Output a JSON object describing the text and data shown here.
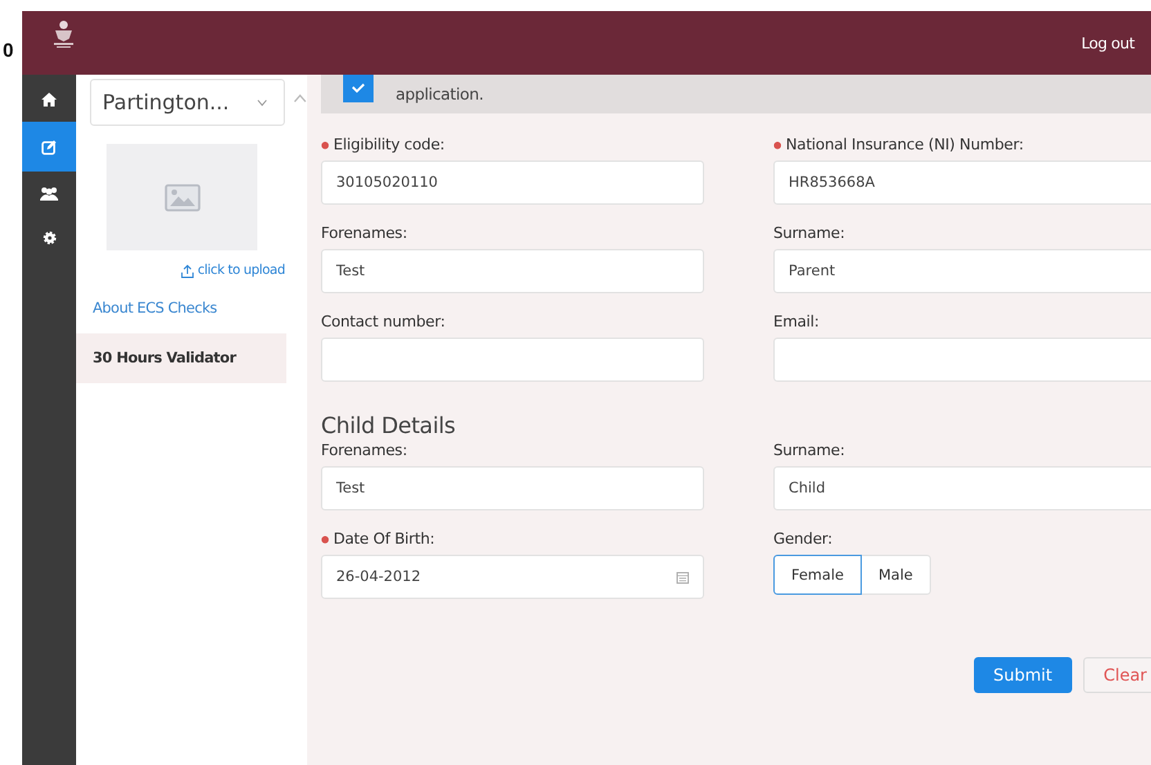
{
  "edge_text": "0",
  "header": {
    "logout": "Log out"
  },
  "rail": [
    {
      "selected": false
    },
    {
      "selected": true
    },
    {
      "selected": false
    },
    {
      "selected": false
    }
  ],
  "sidebar": {
    "select": "Partington...",
    "upload": "click to upload",
    "items": [
      {
        "label": "About ECS Checks",
        "selected": false
      },
      {
        "label": "30 Hours Validator",
        "selected": true
      }
    ]
  },
  "consent": {
    "checked": true,
    "text": "application."
  },
  "fields": [
    {
      "label": "Eligibility code:",
      "required": true,
      "value": "30105020110"
    },
    {
      "label": "National Insurance (NI) Number:",
      "required": true,
      "value": "HR853668A"
    },
    {
      "label": "Forenames:",
      "required": false,
      "value": "Test"
    },
    {
      "label": "Surname:",
      "required": false,
      "value": "Parent"
    },
    {
      "label": "Contact number:",
      "required": false
    },
    {
      "label": "Email:",
      "required": false
    }
  ],
  "child": {
    "heading": "Child Details",
    "fields": [
      {
        "label": "Forenames:",
        "required": false,
        "value": "Test"
      },
      {
        "label": "Surname:",
        "required": false,
        "value": "Child"
      }
    ],
    "dob": {
      "label": "Date Of Birth:",
      "required": true,
      "value": "26-04-2012"
    },
    "gender": {
      "label": "Gender:",
      "options": [
        {
          "label": "Female",
          "selected": true
        },
        {
          "label": "Male",
          "selected": false
        }
      ]
    }
  },
  "buttons": {
    "submit": "Submit",
    "clear": "Clear"
  }
}
